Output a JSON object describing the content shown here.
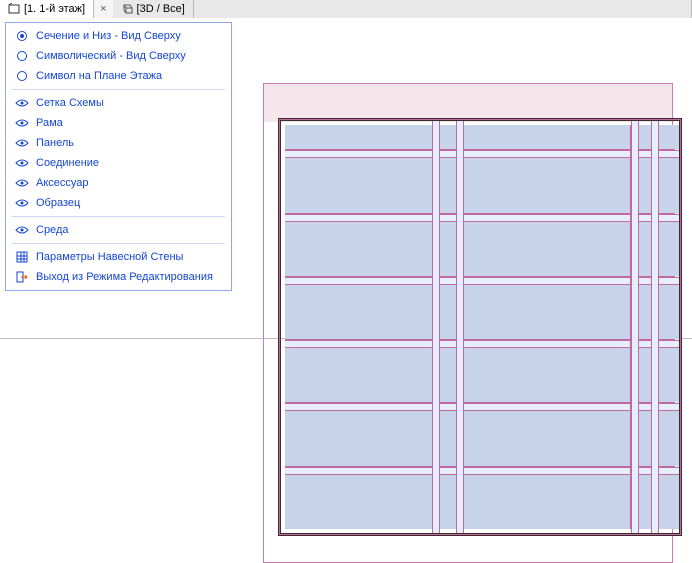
{
  "tabs": {
    "tab1": {
      "label": "[1. 1-й этаж]"
    },
    "tab2": {
      "label": "[3D / Все]"
    }
  },
  "menu": {
    "g1": [
      {
        "label": "Сечение и Низ - Вид Сверху",
        "icon": "radio-on"
      },
      {
        "label": "Символический - Вид Сверху",
        "icon": "radio-off"
      },
      {
        "label": "Символ на Плане Этажа",
        "icon": "radio-off"
      }
    ],
    "g2": [
      {
        "label": "Сетка Схемы",
        "icon": "eye"
      },
      {
        "label": "Рама",
        "icon": "eye"
      },
      {
        "label": "Панель",
        "icon": "eye"
      },
      {
        "label": "Соединение",
        "icon": "eye"
      },
      {
        "label": "Аксессуар",
        "icon": "eye"
      },
      {
        "label": "Образец",
        "icon": "eye"
      }
    ],
    "g3": [
      {
        "label": "Среда",
        "icon": "eye"
      }
    ],
    "g4": [
      {
        "label": "Параметры Навесной Стены",
        "icon": "grid"
      },
      {
        "label": "Выход из Режима Редактирования",
        "icon": "exit"
      }
    ]
  }
}
